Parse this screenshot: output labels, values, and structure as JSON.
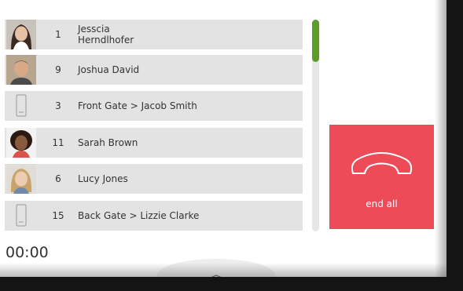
{
  "calls": [
    {
      "number": "1",
      "name_line1": "Jesscia",
      "name_line2": "Herndlhofer",
      "avatar": "woman-photo"
    },
    {
      "number": "9",
      "name_line1": "Joshua David",
      "name_line2": "",
      "avatar": "man-photo"
    },
    {
      "number": "3",
      "name_line1": "Front Gate  > Jacob Smith",
      "name_line2": "",
      "avatar": "intercom-device-icon"
    },
    {
      "number": "11",
      "name_line1": "Sarah Brown",
      "name_line2": "",
      "avatar": "woman-curly-photo"
    },
    {
      "number": "6",
      "name_line1": "Lucy Jones",
      "name_line2": "",
      "avatar": "woman-blonde-photo"
    },
    {
      "number": "15",
      "name_line1": "Back Gate  > Lizzie Clarke",
      "name_line2": "",
      "avatar": "intercom-device-icon"
    }
  ],
  "end_all": {
    "label": "end all",
    "icon": "hang-up-phone-icon",
    "color": "#ec4b57"
  },
  "timer": "00:00",
  "scroll": {
    "position": 0.0
  },
  "colors": {
    "row_bg": "#e3e3e3",
    "scroll_thumb": "#5a9e2a",
    "accent": "#ec4b57"
  }
}
